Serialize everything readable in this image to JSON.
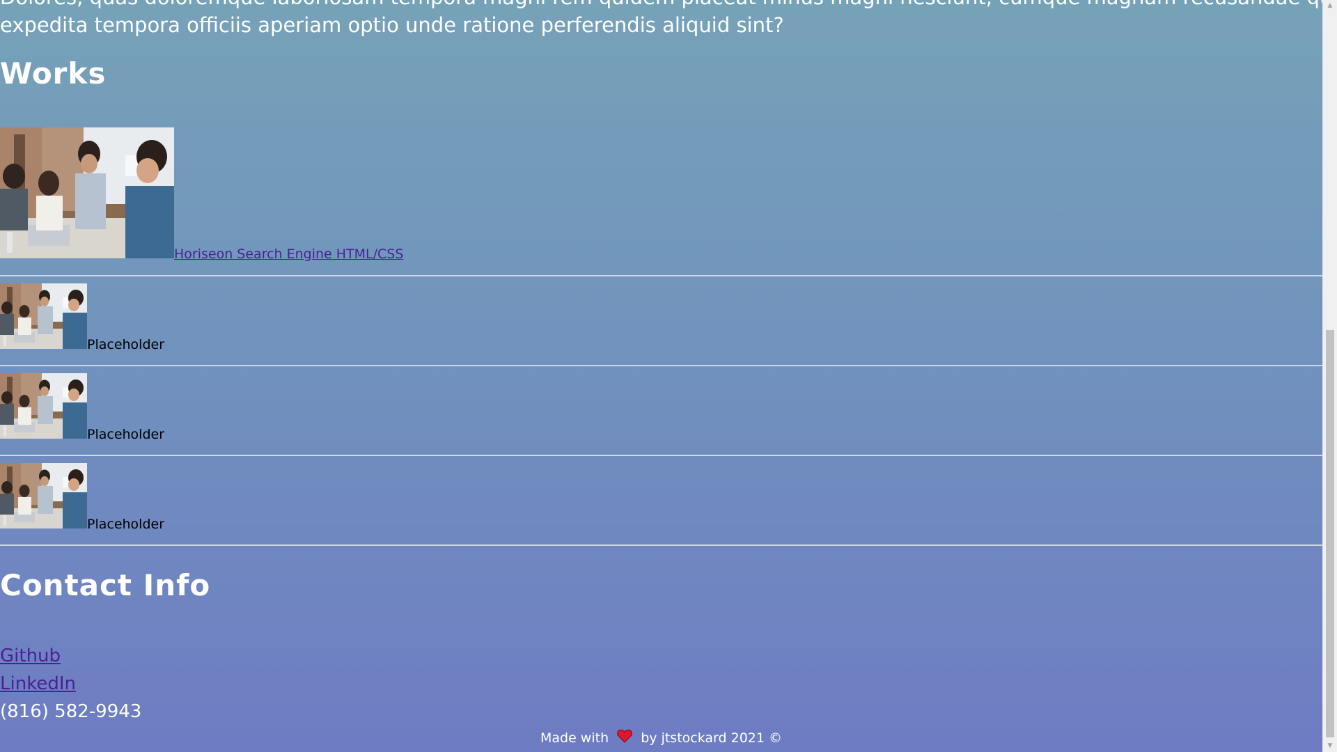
{
  "intro": {
    "cut_line": "Dolores, quas doloremque laboriosam tempora magni rem quidem placeat minus magni nesciunt, cumque magnam recusandae quod voluptate",
    "last_line": "expedita tempora officiis aperiam optio unde ratione perferendis aliquid sint?"
  },
  "works": {
    "heading": "Works",
    "items": [
      {
        "label": "Horiseon Search Engine HTML/CSS",
        "image": "team-meeting-photo",
        "is_link": true
      },
      {
        "label": "Placeholder",
        "image": "team-meeting-photo",
        "is_link": false
      },
      {
        "label": "Placeholder",
        "image": "team-meeting-photo",
        "is_link": false
      },
      {
        "label": "Placeholder",
        "image": "team-meeting-photo",
        "is_link": false
      }
    ]
  },
  "contact": {
    "heading": "Contact Info",
    "github_label": "Github",
    "linkedin_label": "LinkedIn",
    "phone": "(816) 582-9943"
  },
  "footer": {
    "prefix": "Made with",
    "icon": "heart-icon",
    "suffix": "by jtstockard 2021 ©"
  },
  "colors": {
    "gradient_top": "#76a2b8",
    "gradient_bottom": "#6e7cc3",
    "link": "#4b1f96",
    "heart": "#e0162b",
    "divider": "#d0d8e6"
  },
  "scrollbar": {
    "scroll_position": 0.88
  }
}
